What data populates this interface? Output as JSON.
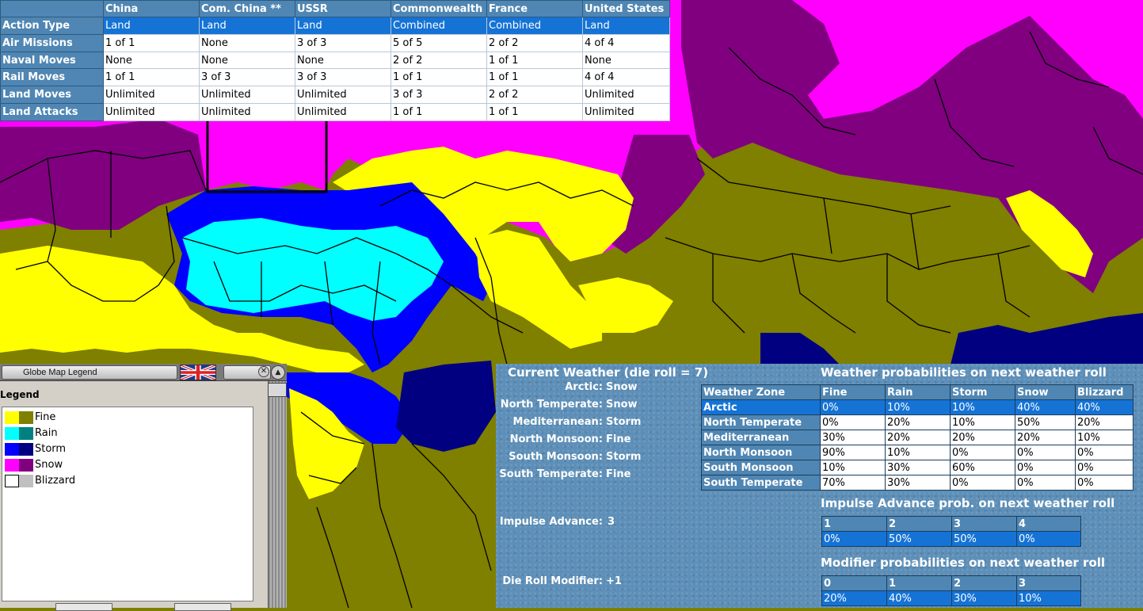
{
  "action_table": {
    "columns": [
      "China",
      "Com. China **",
      "USSR",
      "Commonwealth",
      "France",
      "United States"
    ],
    "rows": [
      {
        "label": "Action Type",
        "values": [
          "Land",
          "Land",
          "Land",
          "Combined",
          "Combined",
          "Land"
        ],
        "selected": true
      },
      {
        "label": "Air Missions",
        "values": [
          "1 of 1",
          "None",
          "3 of 3",
          "5 of 5",
          "2 of 2",
          "4 of 4"
        ]
      },
      {
        "label": "Naval Moves",
        "values": [
          "None",
          "None",
          "None",
          "2 of 2",
          "1 of 1",
          "None"
        ]
      },
      {
        "label": "Rail Moves",
        "values": [
          "1 of 1",
          "3 of 3",
          "3 of 3",
          "1 of 1",
          "1 of 1",
          "4 of 4"
        ]
      },
      {
        "label": "Land Moves",
        "values": [
          "Unlimited",
          "Unlimited",
          "Unlimited",
          "3 of 3",
          "2 of 2",
          "Unlimited"
        ]
      },
      {
        "label": "Land Attacks",
        "values": [
          "Unlimited",
          "Unlimited",
          "Unlimited",
          "1 of 1",
          "1 of 1",
          "Unlimited"
        ]
      }
    ]
  },
  "legend_window": {
    "title": "Globe Map Legend",
    "heading": "Legend",
    "items": [
      {
        "label": "Fine",
        "color_a": "#ffff00",
        "color_b": "#7f7f00"
      },
      {
        "label": "Rain",
        "color_a": "#00ffff",
        "color_b": "#008080"
      },
      {
        "label": "Storm",
        "color_a": "#0000ff",
        "color_b": "#000080"
      },
      {
        "label": "Snow",
        "color_a": "#ff00ff",
        "color_b": "#800080"
      },
      {
        "label": "Blizzard",
        "color_a": "#ffffff",
        "color_b": "#c0c0c0"
      }
    ]
  },
  "weather": {
    "current_title": "Current Weather (die roll = 7)",
    "zones": [
      {
        "zone": "Arctic:",
        "value": "Snow"
      },
      {
        "zone": "North Temperate:",
        "value": "Snow"
      },
      {
        "zone": "Mediterranean:",
        "value": "Storm"
      },
      {
        "zone": "North Monsoon:",
        "value": "Fine"
      },
      {
        "zone": "South Monsoon:",
        "value": "Storm"
      },
      {
        "zone": "South Temperate:",
        "value": "Fine"
      }
    ],
    "impulse_advance_label": "Impulse Advance:",
    "impulse_advance_value": "3",
    "die_roll_modifier_label": "Die Roll Modifier:",
    "die_roll_modifier_value": "+1",
    "prob_title": "Weather probabilities on next weather roll",
    "prob_columns": [
      "Weather Zone",
      "Fine",
      "Rain",
      "Storm",
      "Snow",
      "Blizzard"
    ],
    "prob_rows": [
      {
        "zone": "Arctic",
        "values": [
          "0%",
          "10%",
          "10%",
          "40%",
          "40%"
        ],
        "selected": true
      },
      {
        "zone": "North Temperate",
        "values": [
          "0%",
          "20%",
          "10%",
          "50%",
          "20%"
        ]
      },
      {
        "zone": "Mediterranean",
        "values": [
          "30%",
          "20%",
          "20%",
          "20%",
          "10%"
        ]
      },
      {
        "zone": "North Monsoon",
        "values": [
          "90%",
          "10%",
          "0%",
          "0%",
          "0%"
        ]
      },
      {
        "zone": "South Monsoon",
        "values": [
          "10%",
          "30%",
          "60%",
          "0%",
          "0%"
        ]
      },
      {
        "zone": "South Temperate",
        "values": [
          "70%",
          "30%",
          "0%",
          "0%",
          "0%"
        ]
      }
    ],
    "impulse_title": "Impulse Advance prob. on next weather roll",
    "impulse_columns": [
      "1",
      "2",
      "3",
      "4"
    ],
    "impulse_values": [
      "0%",
      "50%",
      "50%",
      "0%"
    ],
    "modifier_title": "Modifier probabilities on next weather roll",
    "modifier_columns": [
      "0",
      "1",
      "2",
      "3"
    ],
    "modifier_values": [
      "20%",
      "40%",
      "30%",
      "10%"
    ]
  },
  "colors": {
    "fine": "#ffff00",
    "fine_dark": "#7f7f00",
    "rain": "#00ffff",
    "storm": "#0000ff",
    "storm_dark": "#000080",
    "snow": "#ff00ff",
    "snow_dark": "#800080",
    "header_blue": "#4f86b3",
    "select_blue": "#1573d6",
    "panel_blue": "#5d8fb8"
  }
}
